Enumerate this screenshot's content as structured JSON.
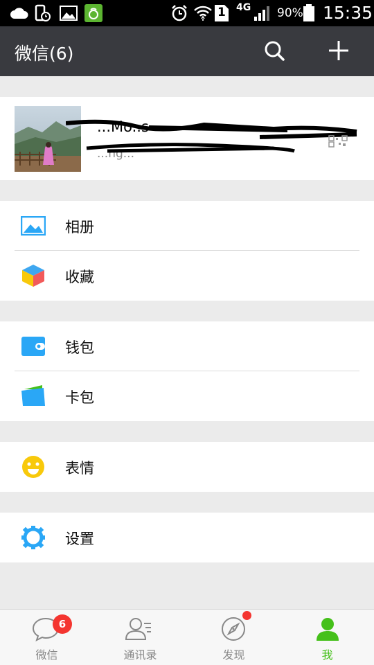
{
  "status_bar": {
    "network_type": "4G",
    "sim_slot": "1",
    "battery_percent": "90%",
    "time": "15:35"
  },
  "header": {
    "title": "微信(6)",
    "search_icon": "search-icon",
    "add_icon": "plus-icon"
  },
  "profile": {
    "name": "...Mo..s",
    "subtitle": "...ng..."
  },
  "menu": {
    "album": {
      "label": "相册",
      "icon": "picture-icon",
      "color": "#2aa7f6"
    },
    "favorites": {
      "label": "收藏",
      "icon": "cube-icon"
    },
    "wallet": {
      "label": "钱包",
      "icon": "wallet-icon",
      "color": "#2aa7f6"
    },
    "cards": {
      "label": "卡包",
      "icon": "card-pack-icon",
      "color": "#2aa7f6"
    },
    "stickers": {
      "label": "表情",
      "icon": "smiley-icon",
      "color": "#f8c90b"
    },
    "settings": {
      "label": "设置",
      "icon": "gear-icon",
      "color": "#2aa7f6"
    }
  },
  "nav": {
    "chats": {
      "label": "微信",
      "badge": "6",
      "icon": "chat-bubble-icon"
    },
    "contacts": {
      "label": "通讯录",
      "icon": "contacts-icon"
    },
    "discover": {
      "label": "发现",
      "icon": "compass-icon"
    },
    "me": {
      "label": "我",
      "icon": "person-icon",
      "active_color": "#45c01a"
    }
  }
}
